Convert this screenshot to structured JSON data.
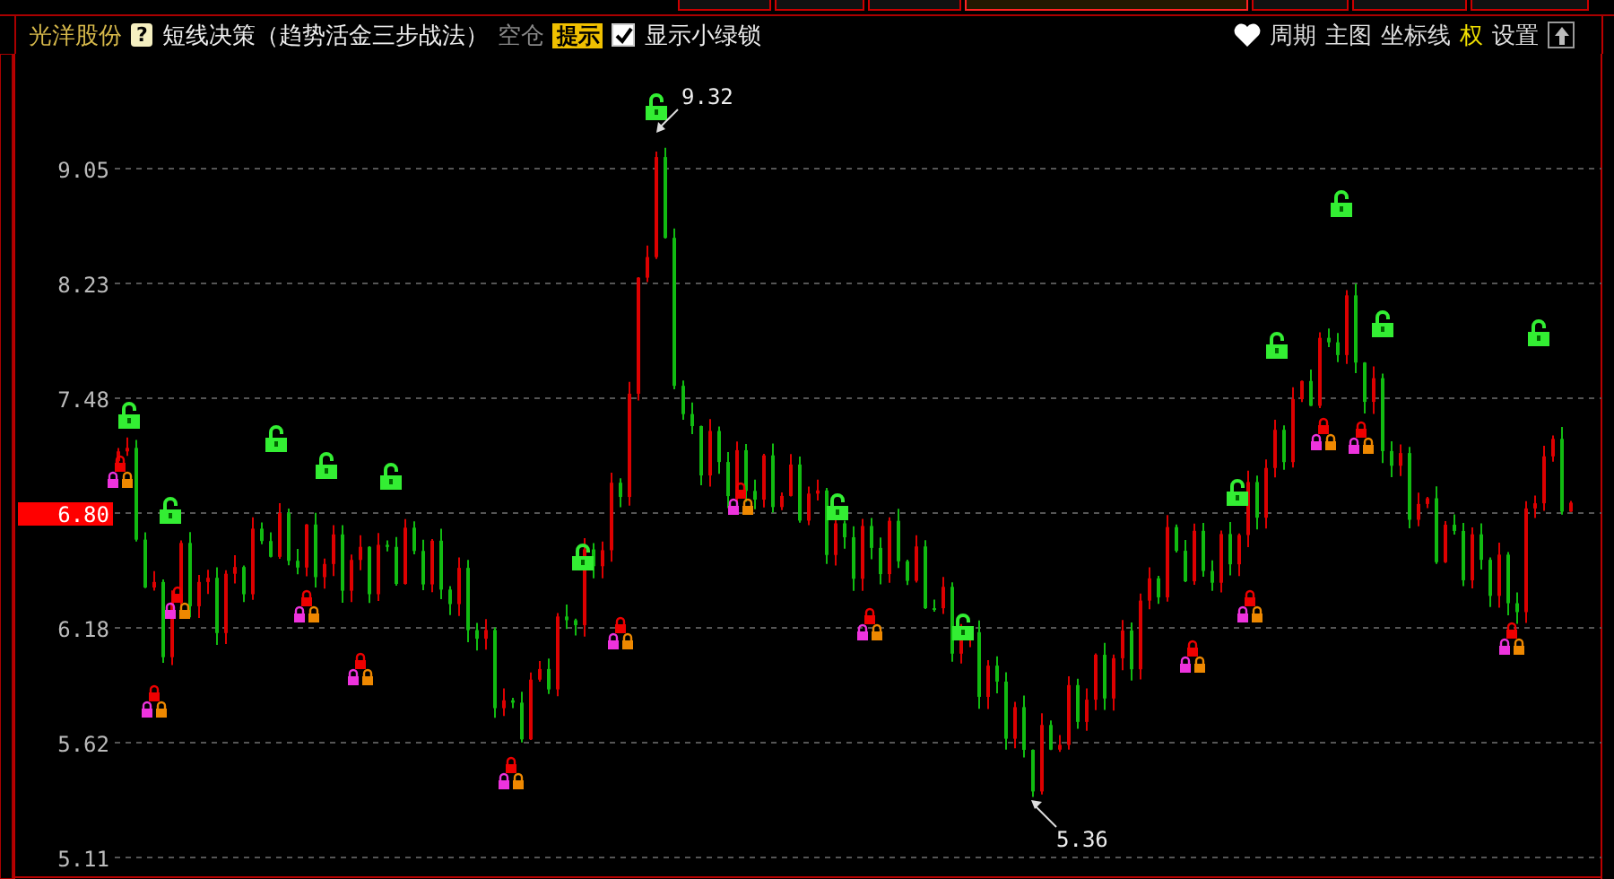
{
  "top_tabs": [
    {
      "selected": false
    },
    {
      "selected": false
    },
    {
      "selected": false
    },
    {
      "selected": true
    },
    {
      "selected": false
    },
    {
      "selected": false
    },
    {
      "selected": false
    }
  ],
  "stock": {
    "name": "光洋股份"
  },
  "help_icon": "?",
  "strategy": {
    "title": "短线决策（趋势活金三步战法）",
    "position": "空仓",
    "hint_button": "提示",
    "show_green_lock": {
      "label": "显示小绿锁",
      "checked": true
    }
  },
  "toolbar": [
    {
      "label": "周期",
      "highlighted": false
    },
    {
      "label": "主图",
      "highlighted": false
    },
    {
      "label": "坐标线",
      "highlighted": false
    },
    {
      "label": "权",
      "highlighted": true
    },
    {
      "label": "设置",
      "highlighted": false
    }
  ],
  "chart": {
    "y_ticks": [
      {
        "label": "9.05",
        "current": false
      },
      {
        "label": "8.23",
        "current": false
      },
      {
        "label": "7.48",
        "current": false
      },
      {
        "label": "6.80",
        "current": true
      },
      {
        "label": "6.18",
        "current": false
      },
      {
        "label": "5.62",
        "current": false
      },
      {
        "label": "5.11",
        "current": false
      }
    ],
    "high_marker": "9.32",
    "low_marker": "5.36"
  }
}
